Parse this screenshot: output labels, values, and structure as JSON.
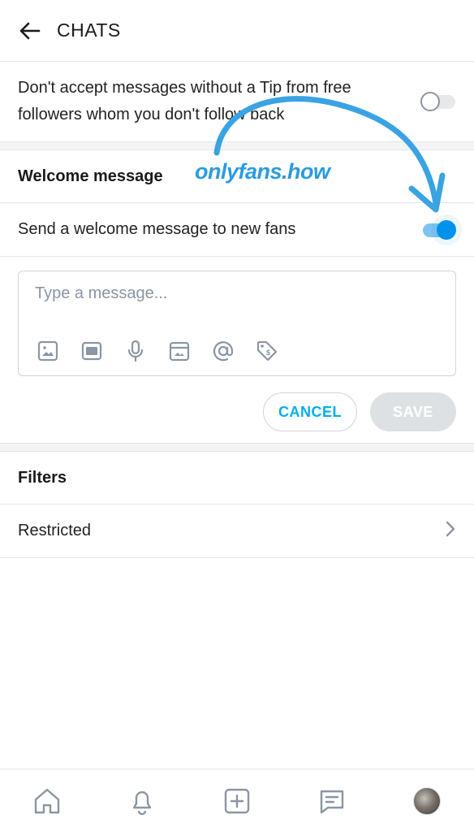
{
  "header": {
    "title": "CHATS"
  },
  "tip_setting": {
    "label": "Don't accept messages without a Tip from free followers whom you don't follow back",
    "enabled": false
  },
  "welcome": {
    "section_title": "Welcome message",
    "toggle_label": "Send a welcome message to new fans",
    "enabled": true,
    "composer": {
      "placeholder": "Type a message...",
      "value": "",
      "tools": [
        "image-icon",
        "gif-icon",
        "microphone-icon",
        "vault-icon",
        "mention-icon",
        "price-tag-icon"
      ]
    },
    "cancel_label": "CANCEL",
    "save_label": "SAVE"
  },
  "filters": {
    "section_title": "Filters",
    "items": [
      {
        "label": "Restricted"
      }
    ]
  },
  "watermark": "onlyfans.how",
  "bottom_nav": [
    "home-icon",
    "bell-icon",
    "add-post-icon",
    "messages-icon",
    "avatar"
  ],
  "colors": {
    "accent": "#00aff0",
    "toggle_on": "#0091ea",
    "watermark": "#2b9be0"
  }
}
